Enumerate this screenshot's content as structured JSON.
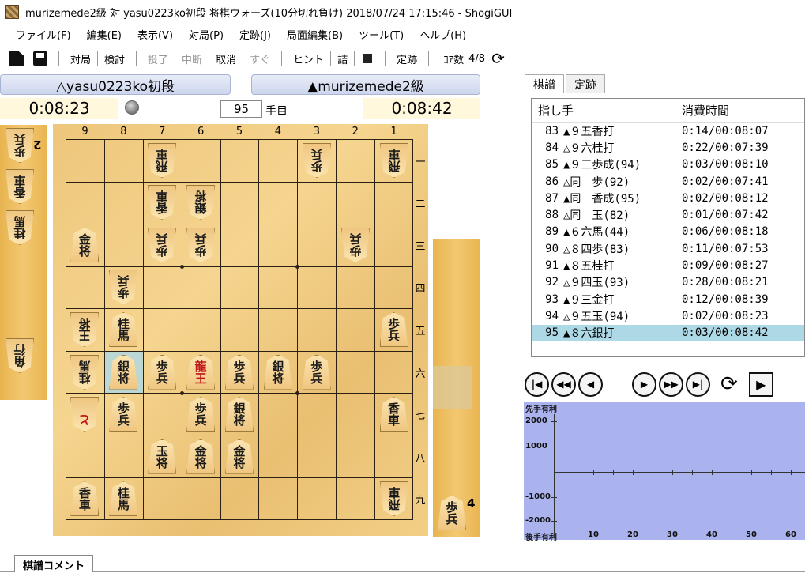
{
  "window": {
    "title": "murizemede2級 対 yasu0223ko初段 将棋ウォーズ(10分切れ負け) 2018/07/24 17:15:46 - ShogiGUI"
  },
  "menu": [
    "ファイル(F)",
    "編集(E)",
    "表示(V)",
    "対局(P)",
    "定跡(J)",
    "局面編集(B)",
    "ツール(T)",
    "ヘルプ(H)"
  ],
  "toolbar": {
    "taikyoku": "対局",
    "kento": "検討",
    "toryo": "投了",
    "chudan": "中断",
    "torikeshi": "取消",
    "sugu": "すぐ",
    "hint": "ヒント",
    "tsume": "詰",
    "joseki": "定跡",
    "core_label": "ｺｱ数",
    "core_value": "4/8"
  },
  "players": {
    "gote_name": "△yasu0223ko初段",
    "sente_name": "▲murizemede2級",
    "gote_time": "0:08:23",
    "sente_time": "0:08:42",
    "move_number": "95",
    "move_unit": "手目"
  },
  "board": {
    "files": [
      "9",
      "8",
      "7",
      "6",
      "5",
      "4",
      "3",
      "2",
      "1"
    ],
    "ranks": [
      "一",
      "二",
      "三",
      "四",
      "五",
      "六",
      "七",
      "八",
      "九"
    ],
    "pieces": [
      {
        "file": 7,
        "rank": 1,
        "glyph": [
          "飛",
          "車"
        ],
        "side": "gote",
        "promoted": false
      },
      {
        "file": 3,
        "rank": 1,
        "glyph": [
          "歩",
          "兵"
        ],
        "side": "gote",
        "promoted": false
      },
      {
        "file": 1,
        "rank": 1,
        "glyph": [
          "飛",
          "車"
        ],
        "side": "gote",
        "promoted": false
      },
      {
        "file": 7,
        "rank": 2,
        "glyph": [
          "香",
          "車"
        ],
        "side": "gote",
        "promoted": false
      },
      {
        "file": 6,
        "rank": 2,
        "glyph": [
          "銀",
          "将"
        ],
        "side": "gote",
        "promoted": false
      },
      {
        "file": 9,
        "rank": 3,
        "glyph": [
          "金",
          "将"
        ],
        "side": "sente",
        "promoted": false
      },
      {
        "file": 7,
        "rank": 3,
        "glyph": [
          "歩",
          "兵"
        ],
        "side": "gote",
        "promoted": false
      },
      {
        "file": 6,
        "rank": 3,
        "glyph": [
          "歩",
          "兵"
        ],
        "side": "gote",
        "promoted": false
      },
      {
        "file": 2,
        "rank": 3,
        "glyph": [
          "歩",
          "兵"
        ],
        "side": "gote",
        "promoted": false
      },
      {
        "file": 8,
        "rank": 4,
        "glyph": [
          "歩",
          "兵"
        ],
        "side": "gote",
        "promoted": false
      },
      {
        "file": 9,
        "rank": 5,
        "glyph": [
          "王",
          "将"
        ],
        "side": "gote",
        "promoted": false
      },
      {
        "file": 8,
        "rank": 5,
        "glyph": [
          "桂",
          "馬"
        ],
        "side": "sente",
        "promoted": false
      },
      {
        "file": 1,
        "rank": 5,
        "glyph": [
          "歩",
          "兵"
        ],
        "side": "sente",
        "promoted": false
      },
      {
        "file": 9,
        "rank": 6,
        "glyph": [
          "桂",
          "馬"
        ],
        "side": "gote",
        "promoted": false
      },
      {
        "file": 8,
        "rank": 6,
        "glyph": [
          "銀",
          "将"
        ],
        "side": "sente",
        "promoted": false
      },
      {
        "file": 7,
        "rank": 6,
        "glyph": [
          "歩",
          "兵"
        ],
        "side": "sente",
        "promoted": false
      },
      {
        "file": 6,
        "rank": 6,
        "glyph": [
          "龍",
          "王"
        ],
        "side": "sente",
        "promoted": true
      },
      {
        "file": 5,
        "rank": 6,
        "glyph": [
          "歩",
          "兵"
        ],
        "side": "sente",
        "promoted": false
      },
      {
        "file": 4,
        "rank": 6,
        "glyph": [
          "銀",
          "将"
        ],
        "side": "sente",
        "promoted": false
      },
      {
        "file": 3,
        "rank": 6,
        "glyph": [
          "歩",
          "兵"
        ],
        "side": "sente",
        "promoted": false
      },
      {
        "file": 9,
        "rank": 7,
        "glyph": [
          "と",
          ""
        ],
        "side": "gote",
        "promoted": true
      },
      {
        "file": 8,
        "rank": 7,
        "glyph": [
          "歩",
          "兵"
        ],
        "side": "sente",
        "promoted": false
      },
      {
        "file": 6,
        "rank": 7,
        "glyph": [
          "歩",
          "兵"
        ],
        "side": "sente",
        "promoted": false
      },
      {
        "file": 5,
        "rank": 7,
        "glyph": [
          "銀",
          "将"
        ],
        "side": "sente",
        "promoted": false
      },
      {
        "file": 1,
        "rank": 7,
        "glyph": [
          "香",
          "車"
        ],
        "side": "sente",
        "promoted": false
      },
      {
        "file": 7,
        "rank": 8,
        "glyph": [
          "玉",
          "将"
        ],
        "side": "sente",
        "promoted": false
      },
      {
        "file": 6,
        "rank": 8,
        "glyph": [
          "金",
          "将"
        ],
        "side": "sente",
        "promoted": false
      },
      {
        "file": 5,
        "rank": 8,
        "glyph": [
          "金",
          "将"
        ],
        "side": "sente",
        "promoted": false
      },
      {
        "file": 9,
        "rank": 9,
        "glyph": [
          "香",
          "車"
        ],
        "side": "sente",
        "promoted": false
      },
      {
        "file": 8,
        "rank": 9,
        "glyph": [
          "桂",
          "馬"
        ],
        "side": "sente",
        "promoted": false
      },
      {
        "file": 1,
        "rank": 9,
        "glyph": [
          "飛",
          "車"
        ],
        "side": "gote",
        "promoted": false
      }
    ],
    "highlight": {
      "file": 8,
      "rank": 6
    }
  },
  "hands": {
    "gote": [
      {
        "glyph": [
          "歩",
          "兵"
        ],
        "count": "2"
      },
      {
        "glyph": [
          "香",
          "車"
        ],
        "count": ""
      },
      {
        "glyph": [
          "桂",
          "馬"
        ],
        "count": ""
      },
      {
        "glyph": [
          "角",
          "行"
        ],
        "count": ""
      }
    ],
    "sente": [
      {
        "glyph": [
          "歩",
          "兵"
        ],
        "count": "4"
      }
    ]
  },
  "tabs": [
    "棋譜",
    "定跡"
  ],
  "kifu": {
    "header_move": "指し手",
    "header_time": "消費時間",
    "rows": [
      {
        "num": "83",
        "move": "▲９五香打",
        "time": "0:14/00:08:07"
      },
      {
        "num": "84",
        "move": "△９六桂打",
        "time": "0:22/00:07:39"
      },
      {
        "num": "85",
        "move": "▲９三歩成(94)",
        "time": "0:03/00:08:10"
      },
      {
        "num": "86",
        "move": "△同　歩(92)",
        "time": "0:02/00:07:41"
      },
      {
        "num": "87",
        "move": "▲同　香成(95)",
        "time": "0:02/00:08:12"
      },
      {
        "num": "88",
        "move": "△同　玉(82)",
        "time": "0:01/00:07:42"
      },
      {
        "num": "89",
        "move": "▲６六馬(44)",
        "time": "0:06/00:08:18"
      },
      {
        "num": "90",
        "move": "△８四歩(83)",
        "time": "0:11/00:07:53"
      },
      {
        "num": "91",
        "move": "▲８五桂打",
        "time": "0:09/00:08:27"
      },
      {
        "num": "92",
        "move": "△９四玉(93)",
        "time": "0:28/00:08:21"
      },
      {
        "num": "93",
        "move": "▲９三金打",
        "time": "0:12/00:08:39"
      },
      {
        "num": "94",
        "move": "△９五玉(94)",
        "time": "0:02/00:08:23"
      },
      {
        "num": "95",
        "move": "▲８六銀打",
        "time": "0:03/00:08:42"
      }
    ],
    "selected_index": 12
  },
  "nav": {
    "first": "|◀",
    "back_many": "◀◀",
    "back": "◀",
    "forward": "▶",
    "forward_many": "▶▶",
    "last": "▶|",
    "rotate": "⟳",
    "play": "▶"
  },
  "graph": {
    "top_label": "先手有利",
    "bottom_label": "後手有利",
    "y_ticks": [
      "2000",
      "1000",
      "-1000",
      "-2000"
    ],
    "x_ticks": [
      "10",
      "20",
      "30",
      "40",
      "50",
      "60"
    ],
    "background": "#aab3ee"
  },
  "bottom_tab": "棋譜コメント"
}
